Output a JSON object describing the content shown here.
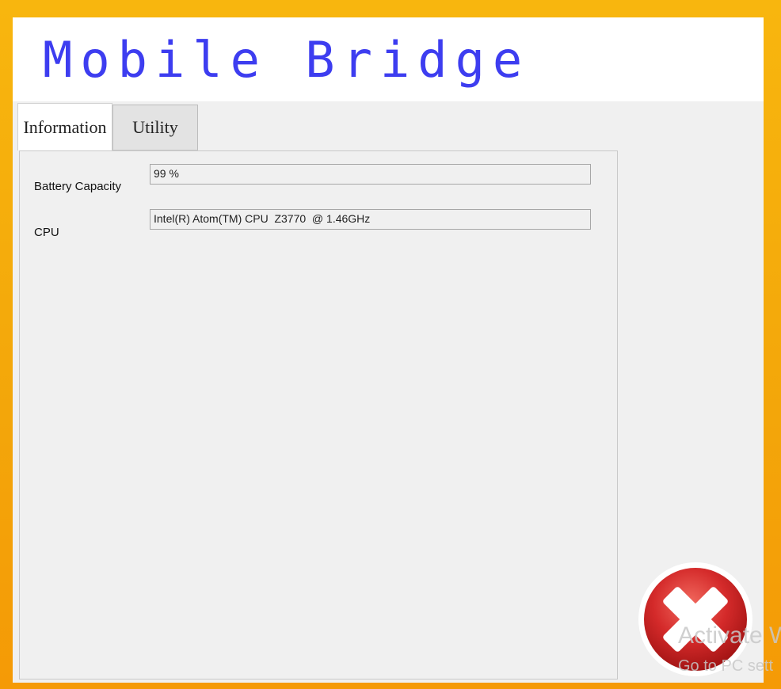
{
  "app": {
    "banner_title": "Mobile Bridge"
  },
  "tabs": [
    {
      "label": "Information",
      "active": true
    },
    {
      "label": "Utility",
      "active": false
    }
  ],
  "information": {
    "battery_label": "Battery Capacity",
    "battery_value": "99 %",
    "cpu_label": "CPU",
    "cpu_value": "Intel(R) Atom(TM) CPU  Z3770  @ 1.46GHz"
  },
  "overlay": {
    "icon": "error-x-icon",
    "icon_color": "#d42a2a",
    "watermark_line1": "Activate W",
    "watermark_line2": "Go to PC sett"
  },
  "colors": {
    "desktop": "#f6b40d",
    "banner_text": "#3d3df0",
    "window_bg": "#f0f0f0"
  }
}
